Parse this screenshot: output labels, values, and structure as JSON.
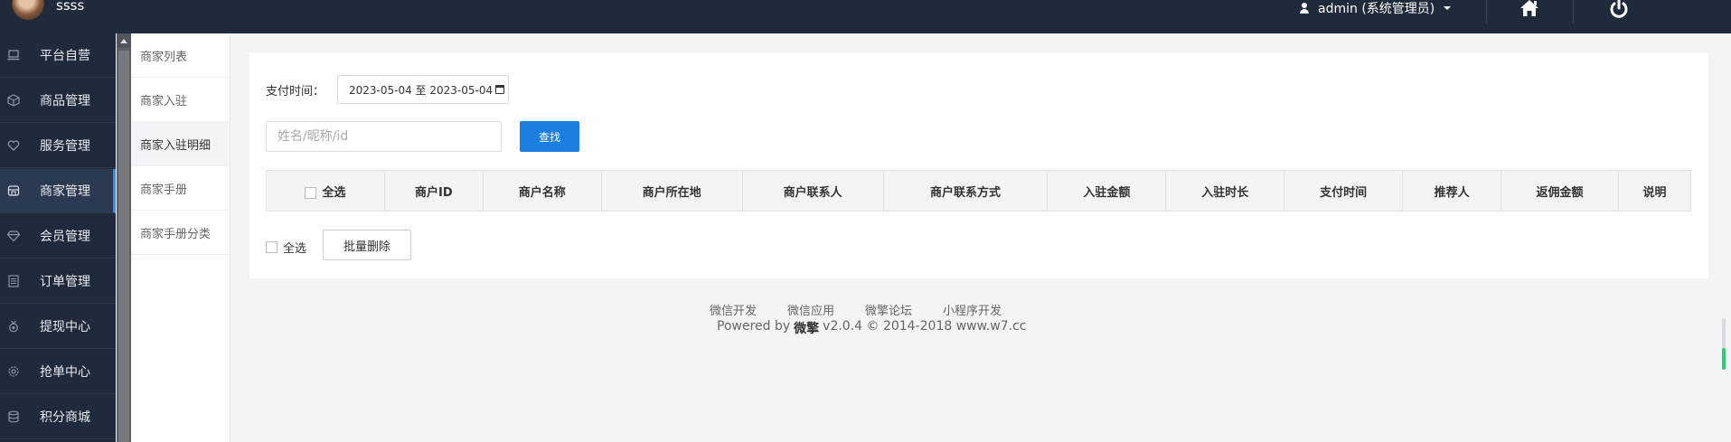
{
  "header": {
    "site_name": "ssss",
    "user_label": "admin (系统管理员)"
  },
  "sidebar": {
    "items": [
      {
        "label": "平台自营",
        "icon": "laptop-icon"
      },
      {
        "label": "商品管理",
        "icon": "cube-icon"
      },
      {
        "label": "服务管理",
        "icon": "heart-icon"
      },
      {
        "label": "商家管理",
        "icon": "store-icon",
        "active": true
      },
      {
        "label": "会员管理",
        "icon": "diamond-icon"
      },
      {
        "label": "订单管理",
        "icon": "list-icon"
      },
      {
        "label": "提现中心",
        "icon": "medal-icon"
      },
      {
        "label": "抢单中心",
        "icon": "gear-icon"
      },
      {
        "label": "积分商城",
        "icon": "database-icon"
      }
    ]
  },
  "subnav": {
    "items": [
      {
        "label": "商家列表"
      },
      {
        "label": "商家入驻"
      },
      {
        "label": "商家入驻明细",
        "active": true
      },
      {
        "label": "商家手册"
      },
      {
        "label": "商家手册分类"
      }
    ]
  },
  "filters": {
    "pay_time_label": "支付时间：",
    "date_range": "2023-05-04 至 2023-05-04",
    "search_placeholder": "姓名/昵称/id",
    "search_value": "",
    "search_button": "查找"
  },
  "table": {
    "select_all": "全选",
    "columns": [
      "商户ID",
      "商户名称",
      "商户所在地",
      "商户联系人",
      "商户联系方式",
      "入驻金额",
      "入驻时长",
      "支付时间",
      "推荐人",
      "返佣金额",
      "说明"
    ],
    "rows": []
  },
  "bulk": {
    "select_all": "全选",
    "batch_delete": "批量删除"
  },
  "footer": {
    "links": [
      "微信开发",
      "微信应用",
      "微擎论坛",
      "小程序开发"
    ],
    "powered_prefix": "Powered by",
    "brand": "微擎",
    "version": "v2.0.4 © 2014-2018 www.w7.cc"
  },
  "colors": {
    "dark_nav": "#1f2a3a",
    "primary": "#1a7fe0",
    "active_indicator": "#2f8ff7"
  }
}
